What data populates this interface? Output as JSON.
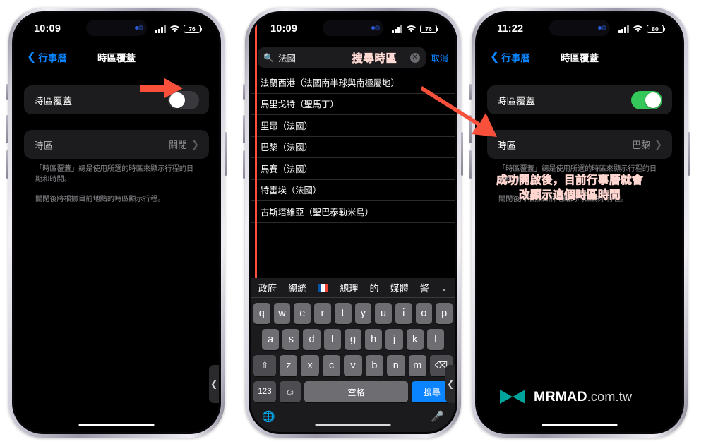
{
  "phone1": {
    "status": {
      "time": "10:09",
      "battery": "76",
      "signal_icon": "cellular-bars-icon",
      "wifi_icon": "wifi-icon",
      "battery_icon": "battery-icon"
    },
    "nav": {
      "back_label": "行事曆",
      "title": "時區覆蓋"
    },
    "rows": {
      "override_label": "時區覆蓋",
      "override_toggle_state": "off",
      "timezone_label": "時區",
      "timezone_value": "關閉"
    },
    "footnotes": [
      "「時區覆蓋」總是使用所選的時區來顯示行程的日期和時間。",
      "關閉後將根據目前地點的時區顯示行程。"
    ],
    "edge_tab_icon": "chevron-left-icon"
  },
  "phone2": {
    "status": {
      "time": "10:09",
      "battery": "76"
    },
    "search": {
      "value": "法國",
      "placeholder": "搜尋",
      "cancel_label": "取消",
      "magnifier_icon": "search-icon",
      "clear_icon": "clear-circle-icon"
    },
    "annotation_search": "搜尋時區",
    "results": [
      "法蘭西港（法國南半球與南極屬地）",
      "馬里戈特（聖馬丁）",
      "里昂（法國）",
      "巴黎（法國）",
      "馬賽（法國）",
      "特雷埃（法國）",
      "古斯塔維亞（聖巴泰勒米島）"
    ],
    "keyboard": {
      "suggestions": [
        "政府",
        "總統",
        "flag-france-icon",
        "總理",
        "的",
        "媒體",
        "警"
      ],
      "collapse_icon": "chevron-down-icon",
      "row1": [
        "q",
        "w",
        "e",
        "r",
        "t",
        "y",
        "u",
        "i",
        "o",
        "p"
      ],
      "row2": [
        "a",
        "s",
        "d",
        "f",
        "g",
        "h",
        "j",
        "k",
        "l"
      ],
      "row3": [
        "z",
        "x",
        "c",
        "v",
        "b",
        "n",
        "m"
      ],
      "shift_icon": "shift-icon",
      "backspace_icon": "backspace-icon",
      "numbers_label": "123",
      "emoji_icon": "emoji-icon",
      "space_label": "空格",
      "go_label": "搜尋",
      "globe_icon": "globe-icon",
      "mic_icon": "microphone-icon"
    }
  },
  "phone3": {
    "status": {
      "time": "11:22",
      "battery": "80"
    },
    "nav": {
      "back_label": "行事曆",
      "title": "時區覆蓋"
    },
    "rows": {
      "override_label": "時區覆蓋",
      "override_toggle_state": "on",
      "timezone_label": "時區",
      "timezone_value": "巴黎"
    },
    "footnotes": [
      "「時區覆蓋」總是使用所選的時區來顯示行程的日期和時間。",
      "關閉後將根據目前地點的時區顯示行程。"
    ],
    "annotation": "成功開啟後，目前行事曆就會\n改顯示這個時區時間"
  },
  "brand": {
    "logo_icon": "mrmad-bowtie-logo",
    "name": "MRMAD",
    "suffix": ".com.tw",
    "logo_color": "#00a39b"
  },
  "colors": {
    "accent_blue": "#0a84ff",
    "toggle_on_green": "#34c759",
    "annotation_red": "#ff4d3d",
    "annotation_text": "#ff6a5a"
  }
}
